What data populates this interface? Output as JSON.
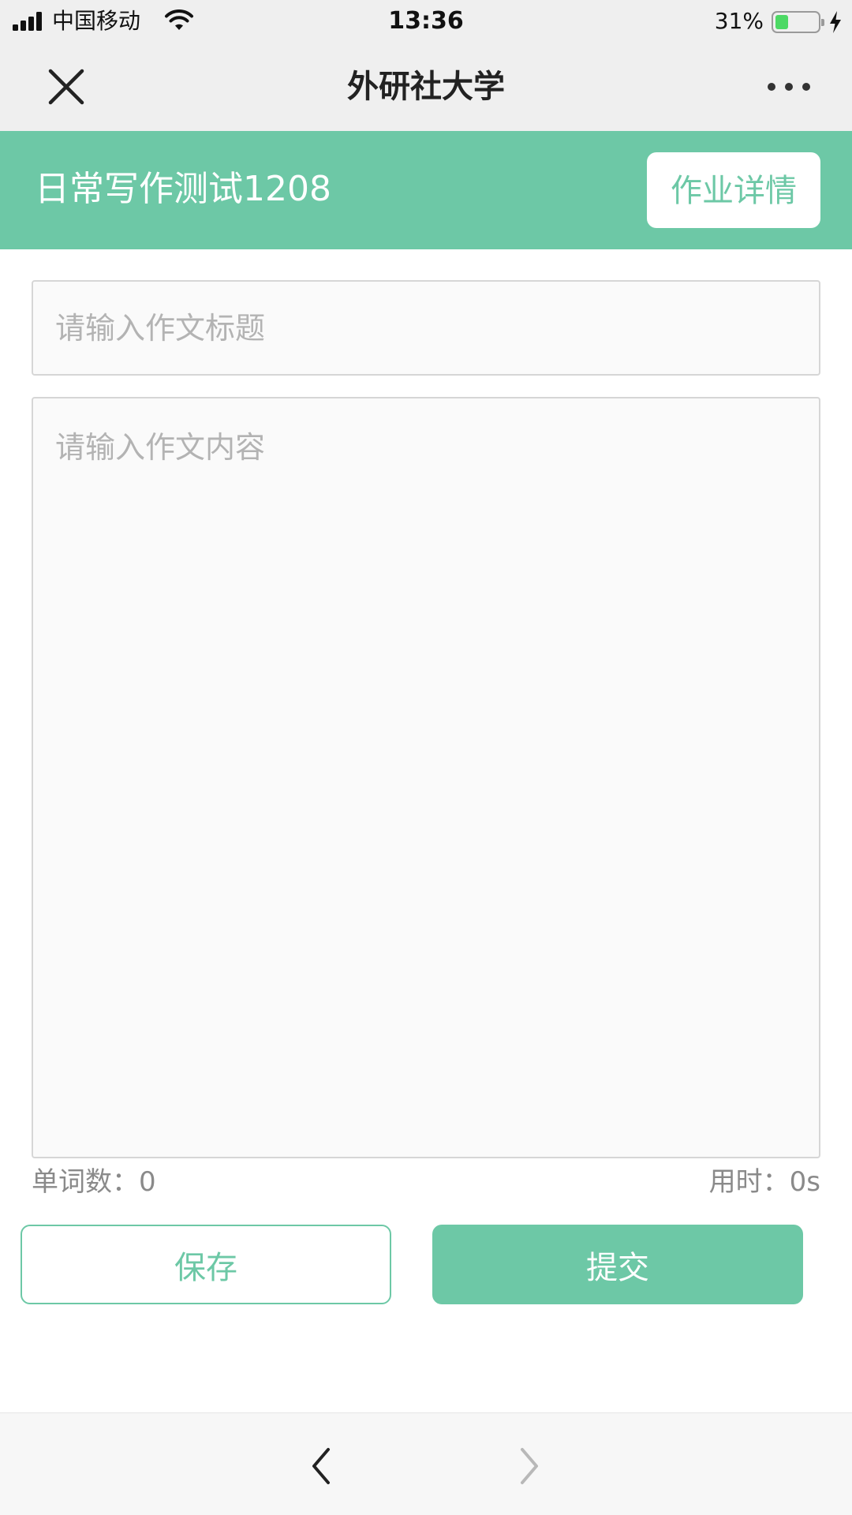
{
  "status_bar": {
    "carrier": "中国移动",
    "time": "13:36",
    "battery_percent_label": "31%",
    "battery_level": 0.31,
    "icons": [
      "signal-icon",
      "wifi-icon",
      "battery-icon",
      "charging-icon"
    ]
  },
  "nav": {
    "title": "外研社大学",
    "icons": [
      "close-icon",
      "more-icon"
    ]
  },
  "assignment": {
    "title": "日常写作测试1208",
    "detail_button": "作业详情"
  },
  "form": {
    "title_placeholder": "请输入作文标题",
    "title_value": "",
    "content_placeholder": "请输入作文内容",
    "content_value": "",
    "word_count_label": "单词数：",
    "word_count": "0",
    "time_label": "用时：",
    "time_value": "0s"
  },
  "actions": {
    "save": "保存",
    "submit": "提交"
  },
  "bottom_bar": {
    "icons": [
      "back-arrow-icon",
      "forward-arrow-icon"
    ]
  },
  "colors": {
    "accent": "#6dc8a6",
    "bar_background": "#efefef",
    "placeholder": "#b3b3b3",
    "battery_fill": "#4cd964"
  }
}
